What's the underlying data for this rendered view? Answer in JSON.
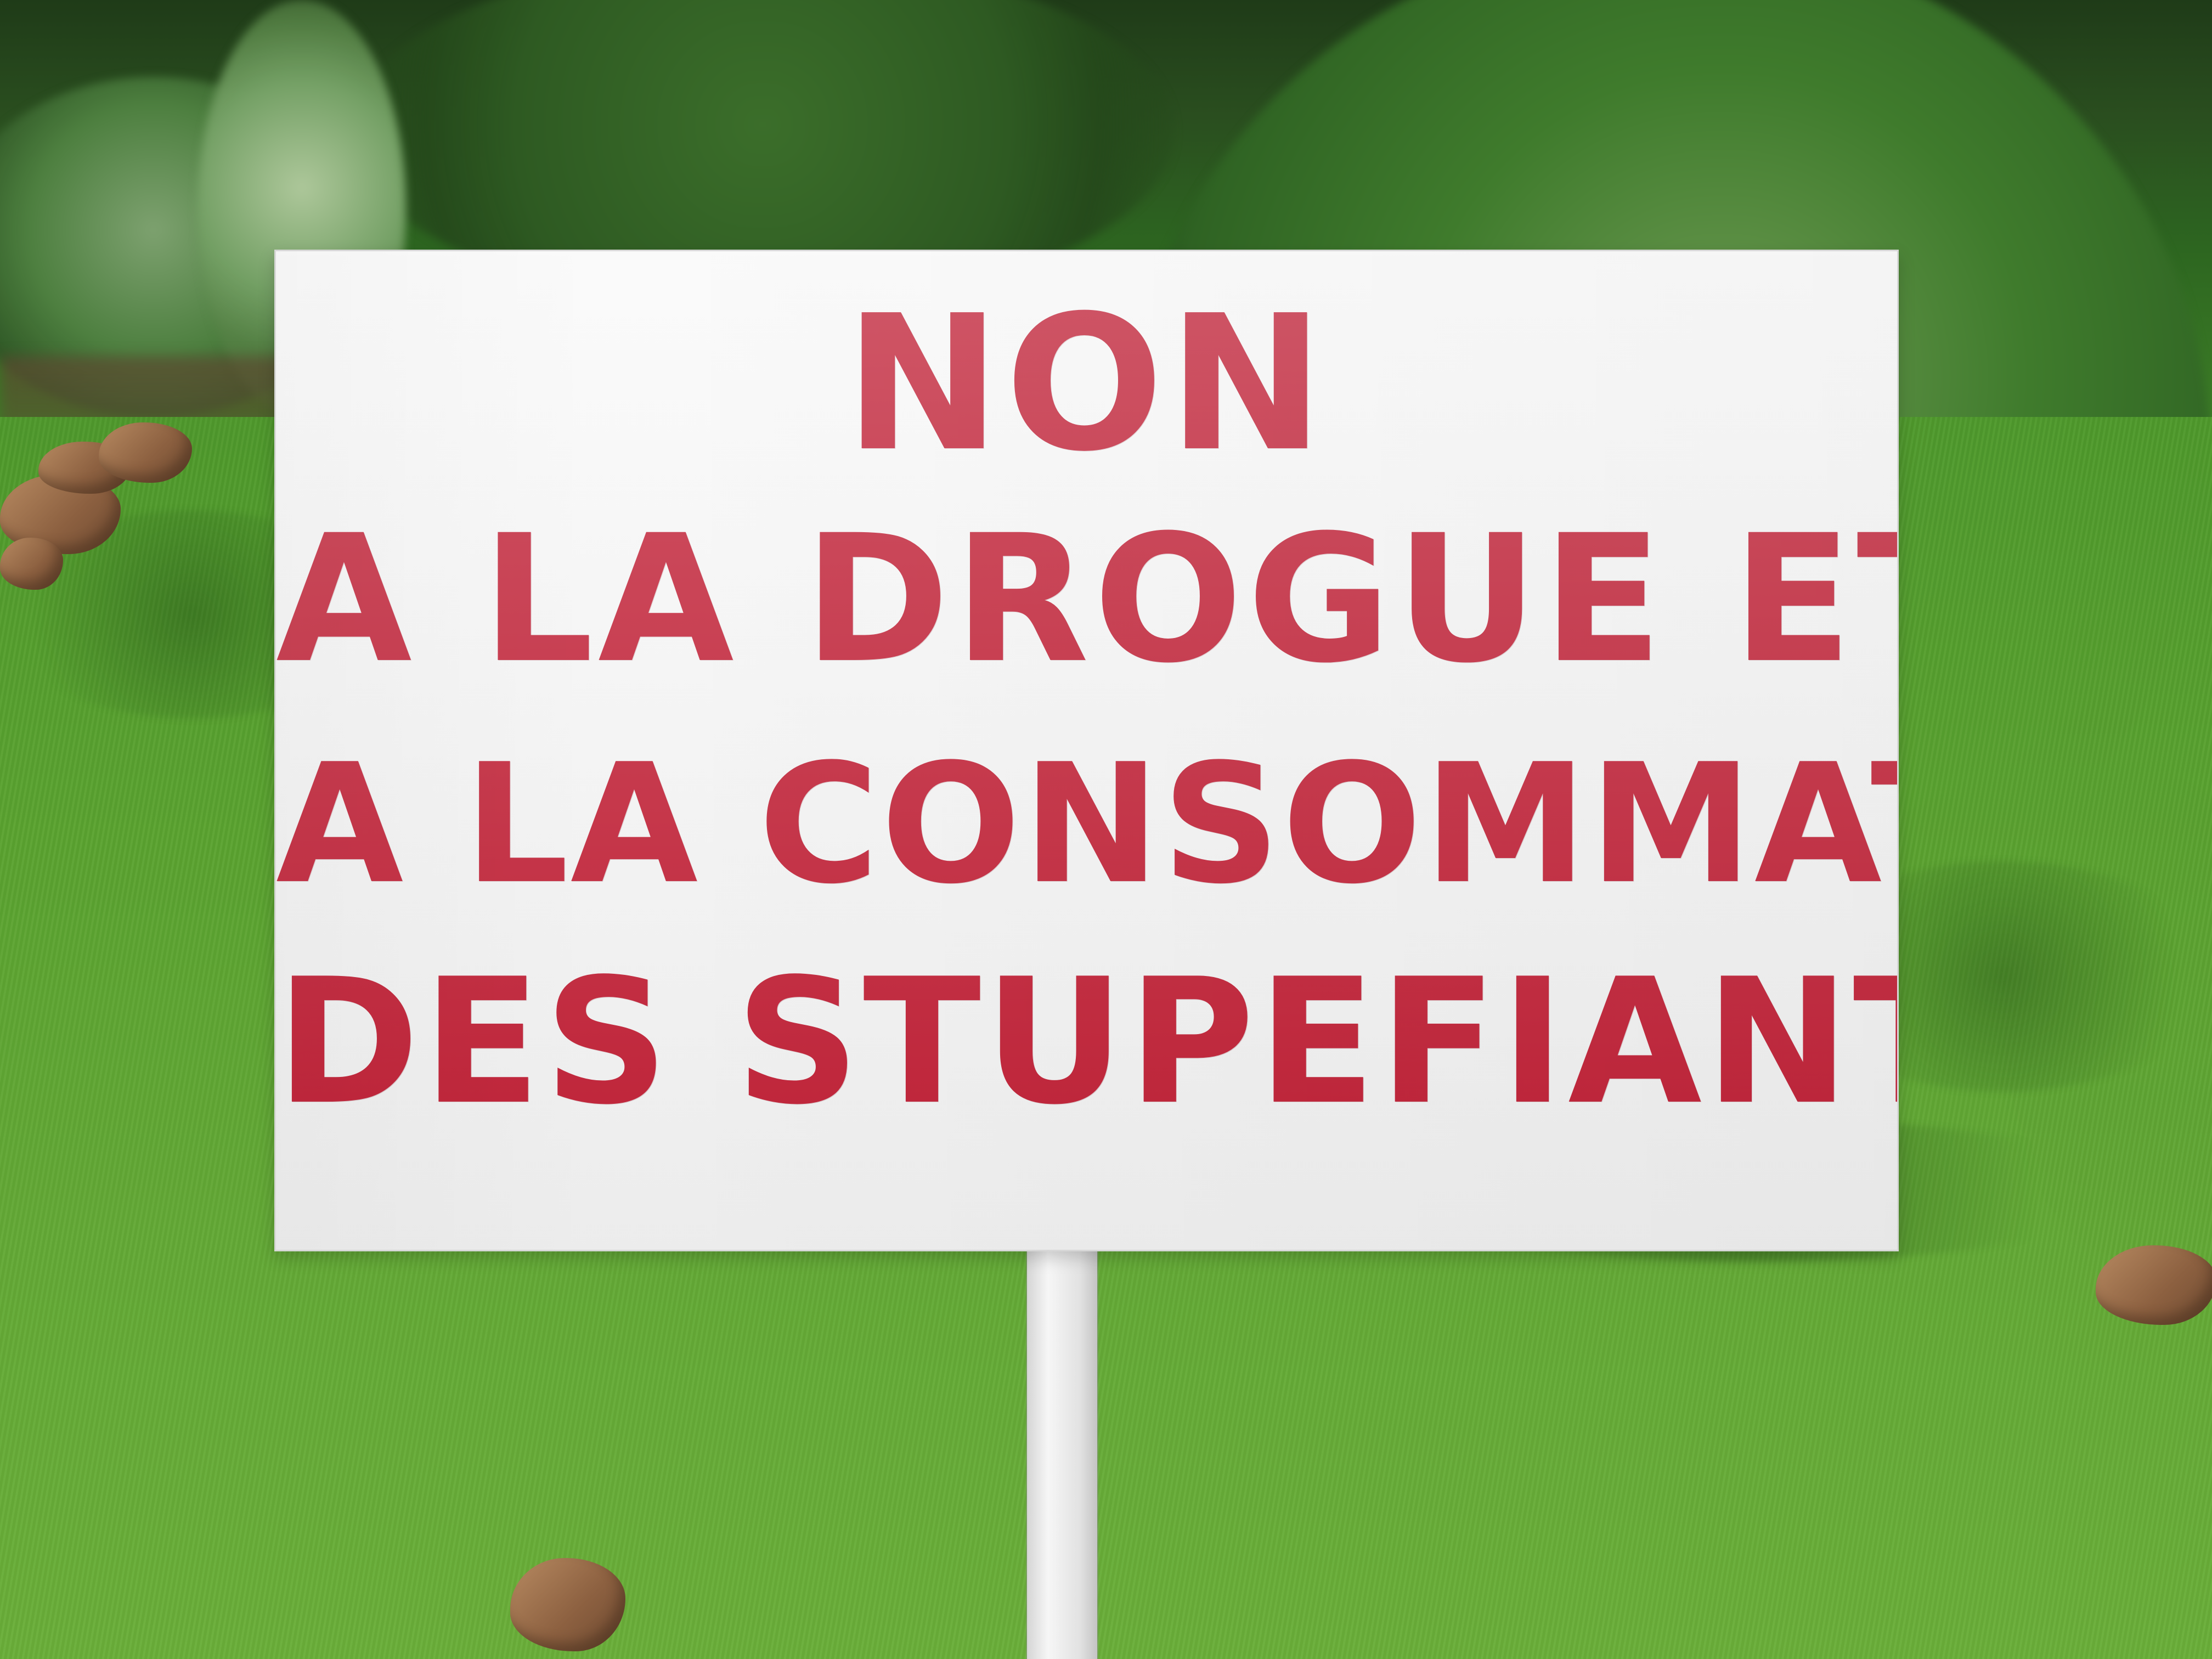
{
  "scene": {
    "background_colors": {
      "grass": "#5ea632",
      "hedge": "#2f6323",
      "sign_board": "#f5f5f5",
      "lettering": "#c11f35",
      "post": "#ededed"
    }
  },
  "sign": {
    "line_1": "NON",
    "line_2": "A LA DROGUE ET",
    "line_3": "A LA CONSOMMATION",
    "line_4": "DES STUPEFIANTS"
  }
}
